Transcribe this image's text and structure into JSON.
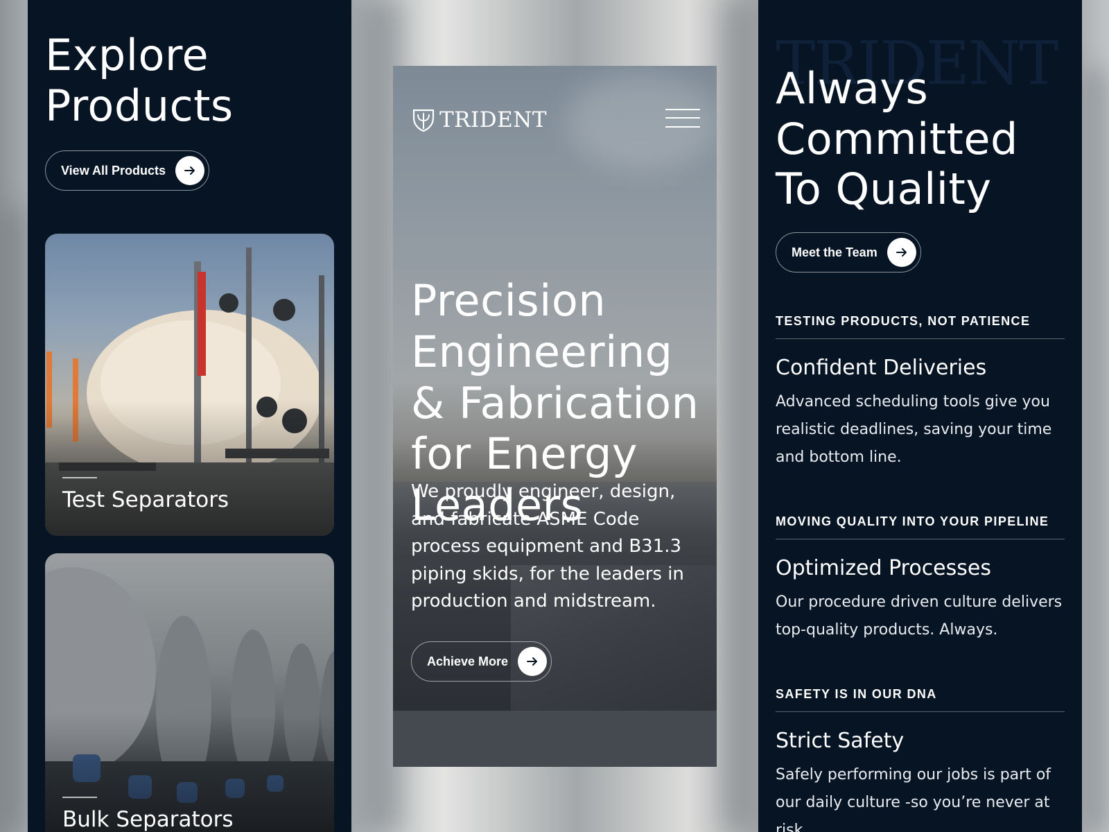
{
  "left_panel": {
    "title": "Explore Products",
    "button_label": "View All Products",
    "products": [
      {
        "label": "Test Separators"
      },
      {
        "label": "Bulk Separators"
      }
    ]
  },
  "hero": {
    "logo_text": "TRIDENT",
    "title": "Precision Engineering & Fabrication for Energy Leaders",
    "body": "We proudly engineer, design, and fabricate ASME Code process equipment and B31.3 piping skids, for the leaders in production and midstream.",
    "button_label": "Achieve More"
  },
  "right_panel": {
    "watermark": "TRIDENT",
    "title": "Always Committed To Quality",
    "button_label": "Meet the Team",
    "features": [
      {
        "eyebrow": "TESTING PRODUCTS, NOT PATIENCE",
        "title": "Confident Deliveries",
        "description": "Advanced scheduling tools give you realistic deadlines, saving your time and bottom line."
      },
      {
        "eyebrow": "MOVING QUALITY INTO YOUR PIPELINE",
        "title": "Optimized Processes",
        "description": "Our procedure driven culture delivers top-quality products. Always."
      },
      {
        "eyebrow": "SAFETY IS IN OUR DNA",
        "title": "Strict Safety",
        "description": "Safely performing our jobs is part of our daily culture -so you’re never at risk."
      }
    ]
  },
  "icons": {
    "arrow": "arrow-right-icon",
    "menu": "hamburger-menu-icon",
    "logo": "trident-shield-icon"
  },
  "colors": {
    "panel_bg": "#061424",
    "text": "#ffffff",
    "button_border": "rgba(255,255,255,0.55)"
  }
}
